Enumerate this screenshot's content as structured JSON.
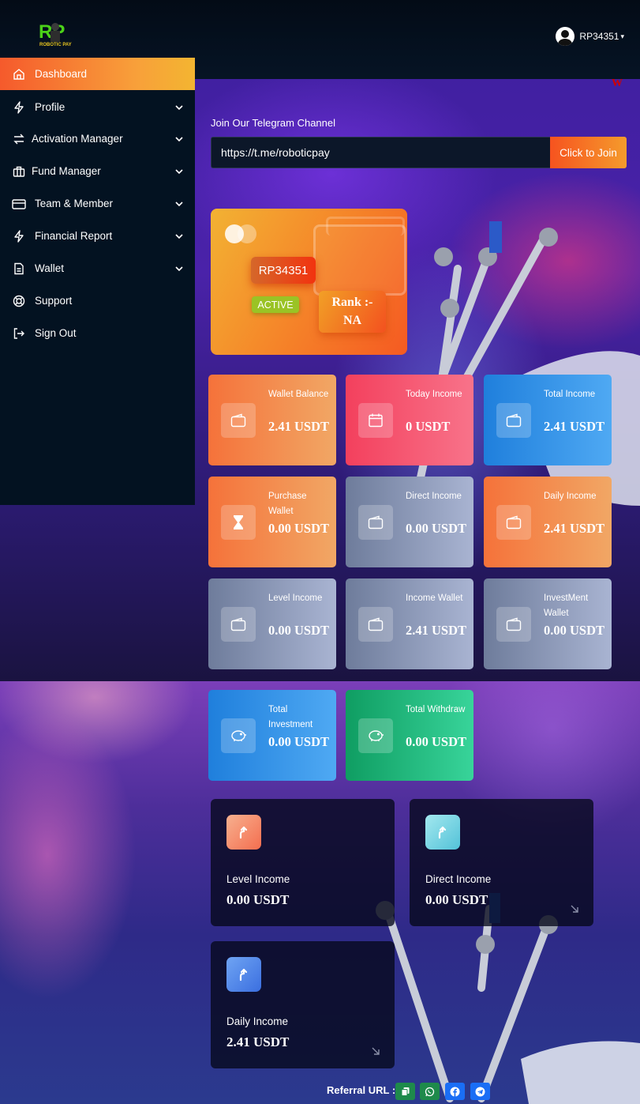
{
  "header": {
    "logo_text": "RP",
    "logo_subtext": "ROBOTIC PAY",
    "user_id": "RP34351",
    "user_caret": "▾"
  },
  "sidebar": {
    "items": [
      {
        "label": "Dashboard",
        "icon": "home-icon",
        "has_submenu": false,
        "active": true
      },
      {
        "label": "Profile",
        "icon": "bolt-icon",
        "has_submenu": true
      },
      {
        "label": "Activation Manager",
        "icon": "arrows-exchange-icon",
        "has_submenu": true
      },
      {
        "label": "Fund Manager",
        "icon": "briefcase-icon",
        "has_submenu": true
      },
      {
        "label": "Team & Member",
        "icon": "card-icon",
        "has_submenu": true
      },
      {
        "label": "Financial Report",
        "icon": "bolt-icon",
        "has_submenu": true
      },
      {
        "label": "Wallet",
        "icon": "document-icon",
        "has_submenu": true
      },
      {
        "label": "Support",
        "icon": "lifebuoy-icon",
        "has_submenu": false
      },
      {
        "label": "Sign Out",
        "icon": "sign-out-icon",
        "has_submenu": false
      }
    ]
  },
  "telegram": {
    "label": "Join Our Telegram Channel",
    "url": "https://t.me/roboticpay",
    "button": "Click to Join"
  },
  "member": {
    "id": "RP34351",
    "status": "ACTIVE",
    "rank_label": "Rank :-",
    "rank_value": "NA"
  },
  "stats": [
    {
      "label": "Wallet Balance",
      "value": "2.41 USDT",
      "color": "orange",
      "icon": "wallet-icon"
    },
    {
      "label": "Today Income",
      "value": "0 USDT",
      "color": "red",
      "icon": "calendar-icon"
    },
    {
      "label": "Total Income",
      "value": "2.41 USDT",
      "color": "blue",
      "icon": "wallet-icon"
    },
    {
      "label": "Purchase Wallet",
      "value": "0.00 USDT",
      "color": "orange",
      "icon": "hourglass-icon"
    },
    {
      "label": "Direct Income",
      "value": "0.00 USDT",
      "color": "grey",
      "icon": "wallet-icon"
    },
    {
      "label": "Daily Income",
      "value": "2.41 USDT",
      "color": "orange",
      "icon": "wallet-icon"
    },
    {
      "label": "Level Income",
      "value": "0.00 USDT",
      "color": "grey",
      "icon": "wallet-icon"
    },
    {
      "label": "Income Wallet",
      "value": "2.41 USDT",
      "color": "grey",
      "icon": "wallet-icon"
    },
    {
      "label": "InvestMent Wallet",
      "value": "0.00 USDT",
      "color": "grey",
      "icon": "wallet-icon"
    },
    {
      "label": "Total Investment",
      "value": "0.00 USDT",
      "color": "blue",
      "icon": "piggy-bank-icon"
    },
    {
      "label": "Total Withdraw",
      "value": "0.00 USDT",
      "color": "green",
      "icon": "piggy-bank-icon"
    }
  ],
  "income_cards": [
    {
      "label": "Level Income",
      "value": "0.00 USDT",
      "icon": "turn-up-arrow-icon",
      "accent": "#f98b6f"
    },
    {
      "label": "Direct Income",
      "value": "0.00 USDT",
      "icon": "turn-up-arrow-icon",
      "accent": "#6fd0e0"
    },
    {
      "label": "Daily Income",
      "value": "2.41 USDT",
      "icon": "turn-up-arrow-icon",
      "accent": "#4a86e8"
    }
  ],
  "referral": {
    "label": "Referral URL :",
    "buttons": [
      {
        "icon": "copy-icon",
        "color": "#1e8a4b"
      },
      {
        "icon": "whatsapp-icon",
        "color": "#1e8a4b"
      },
      {
        "icon": "facebook-icon",
        "color": "#1a6ef5"
      },
      {
        "icon": "telegram-icon",
        "color": "#1a6ef5"
      }
    ]
  },
  "watermark": "W"
}
